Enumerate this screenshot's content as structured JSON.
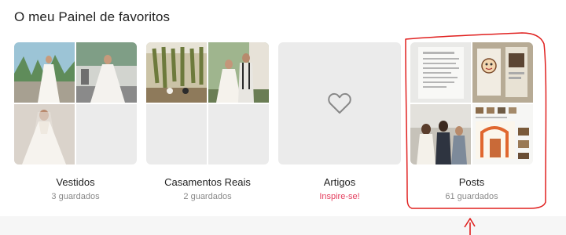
{
  "panel": {
    "title": "O meu Painel de favoritos"
  },
  "cards": [
    {
      "name": "Vestidos",
      "subtitle": "3 guardados",
      "thumbnail": "photo-collage"
    },
    {
      "name": "Casamentos Reais",
      "subtitle": "2 guardados",
      "thumbnail": "photo-collage"
    },
    {
      "name": "Artigos",
      "subtitle": "Inspire-se!",
      "thumbnail": "heart-icon"
    },
    {
      "name": "Posts",
      "subtitle": "61 guardados",
      "thumbnail": "photo-collage"
    }
  ],
  "colors": {
    "accent": "#e4405f",
    "placeholder": "#ebebeb",
    "annotation": "#e0201f",
    "muted_text": "#8a8a8a"
  }
}
